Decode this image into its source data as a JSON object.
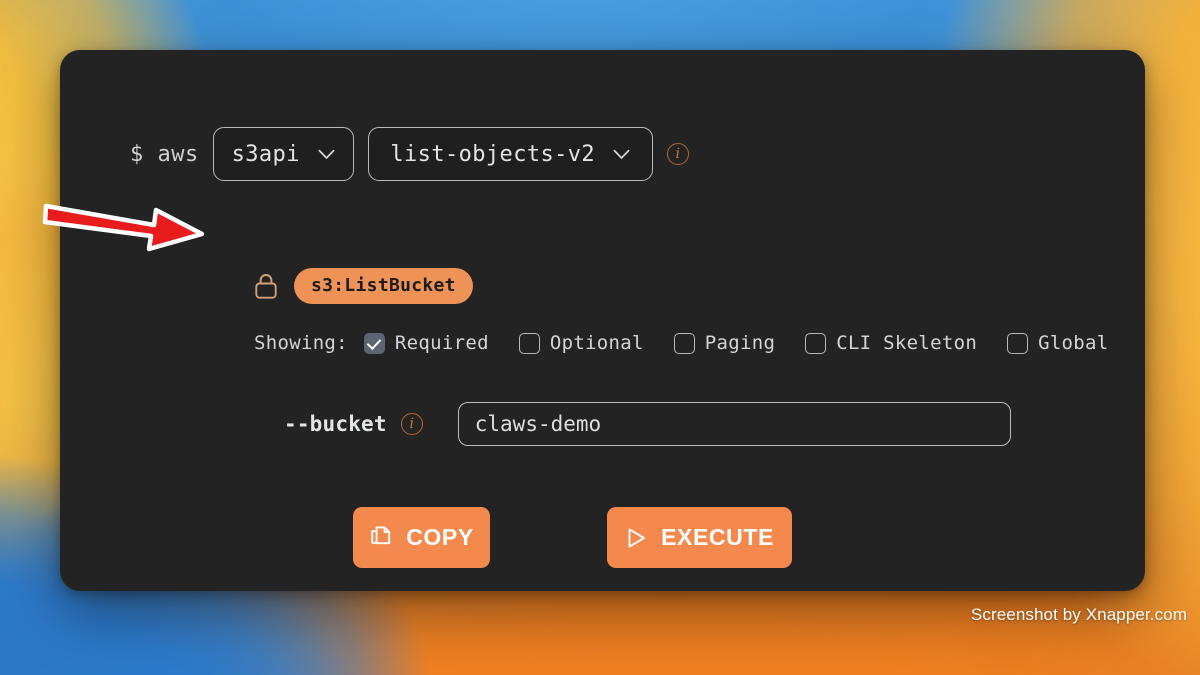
{
  "window": {
    "panel_background": "#232324",
    "accent_orange": "#f4894e",
    "badge_orange": "#ef9255"
  },
  "command": {
    "prompt": "$ aws",
    "service": {
      "value": "s3api",
      "chevron_icon": "chevron-down-icon"
    },
    "operation": {
      "value": "list-objects-v2",
      "chevron_icon": "chevron-down-icon"
    },
    "info_icon": "info-icon",
    "info_glyph": "i"
  },
  "permission": {
    "lock_icon": "lock-icon",
    "badge_label": "s3:ListBucket"
  },
  "showing": {
    "label": "Showing:",
    "options": [
      {
        "label": "Required",
        "checked": true
      },
      {
        "label": "Optional",
        "checked": false
      },
      {
        "label": "Paging",
        "checked": false
      },
      {
        "label": "CLI Skeleton",
        "checked": false
      },
      {
        "label": "Global",
        "checked": false
      }
    ]
  },
  "parameter": {
    "name": "--bucket",
    "info_icon": "info-icon",
    "info_glyph": "i",
    "value": "claws-demo",
    "placeholder": ""
  },
  "actions": {
    "copy": {
      "label": "COPY",
      "icon": "copy-icon"
    },
    "execute": {
      "label": "EXECUTE",
      "icon": "play-icon"
    }
  },
  "annotation": {
    "arrow_icon": "red-arrow-right-icon",
    "arrow_color": "#e81c1c",
    "arrow_outline": "#ffffff"
  },
  "watermark": {
    "text": "Screenshot by Xnapper.com"
  }
}
